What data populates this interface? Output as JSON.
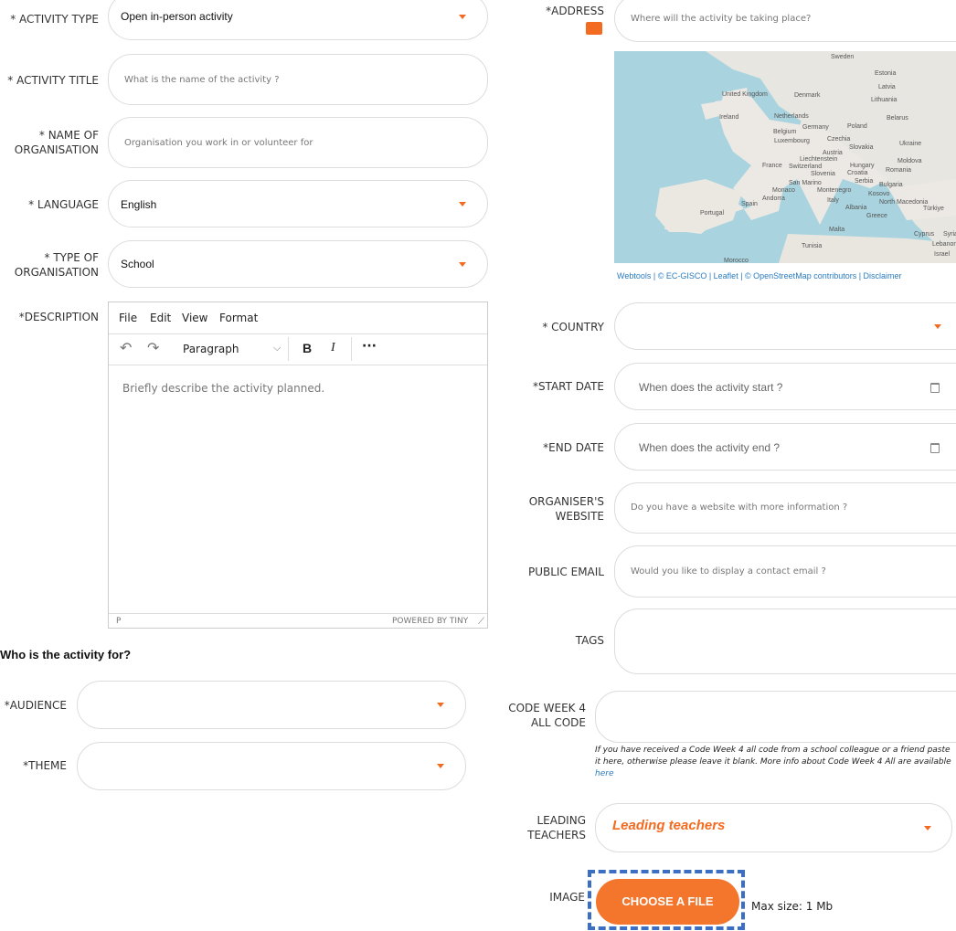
{
  "left": {
    "activity_type": {
      "label": "* ACTIVITY TYPE",
      "value": "Open in-person activity"
    },
    "activity_title": {
      "label": "* ACTIVITY TITLE",
      "placeholder": "What is the name of the activity ?"
    },
    "organisation_name": {
      "label_1": "* NAME OF",
      "label_2": "ORGANISATION",
      "placeholder": "Organisation you work in or volunteer for"
    },
    "language": {
      "label": "* LANGUAGE",
      "value": "English"
    },
    "organisation_type": {
      "label_1": "* TYPE OF",
      "label_2": "ORGANISATION",
      "value": "School"
    },
    "description": {
      "label": "*DESCRIPTION",
      "menu": [
        "File",
        "Edit",
        "View",
        "Format"
      ],
      "block_format": "Paragraph",
      "placeholder": "Briefly describe the activity planned.",
      "path": "P",
      "powered_by": "POWERED BY TINY"
    },
    "section_heading": "Who is the activity for?",
    "audience": {
      "label": "*AUDIENCE"
    },
    "theme": {
      "label": "*THEME"
    }
  },
  "right": {
    "address": {
      "label": "*ADDRESS",
      "placeholder": "Where will the activity be taking place?"
    },
    "map": {
      "labels": [
        "Sweden",
        "Estonia",
        "Latvia",
        "Lithuania",
        "United Kingdom",
        "Denmark",
        "Ireland",
        "Netherlands",
        "Belgium",
        "Germany",
        "Poland",
        "Belarus",
        "Luxembourg",
        "Czechia",
        "Slovakia",
        "Ukraine",
        "France",
        "Liechtenstein",
        "Switzerland",
        "Austria",
        "Hungary",
        "Moldova",
        "Slovenia",
        "Croatia",
        "Romania",
        "San Marino",
        "Serbia",
        "Monaco",
        "Montenegro",
        "Bulgaria",
        "Kosovo",
        "Andorra",
        "Italy",
        "Albania",
        "North Macedonia",
        "Spain",
        "Portugal",
        "Greece",
        "Türkiye",
        "Malta",
        "Tunisia",
        "Cyprus",
        "Syria",
        "Lebanon",
        "Israel",
        "Morocco"
      ],
      "attribution": "Webtools | © EC-GISCO | Leaflet | © OpenStreetMap contributors | Disclaimer"
    },
    "country": {
      "label": "* COUNTRY"
    },
    "start_date": {
      "label": "*START DATE",
      "placeholder": "When does the activity start ?"
    },
    "end_date": {
      "label": "*END DATE",
      "placeholder": "When does the activity end ?"
    },
    "website": {
      "label_1": "ORGANISER'S",
      "label_2": "WEBSITE",
      "placeholder": "Do you have a website with more information ?"
    },
    "public_email": {
      "label": "PUBLIC EMAIL",
      "placeholder": "Would you like to display a contact email ?"
    },
    "tags": {
      "label": "TAGS"
    },
    "code": {
      "label_1": "CODE WEEK 4",
      "label_2": "ALL CODE",
      "help_text": "If you have received a Code Week 4 all code from a school colleague or a friend paste it here, otherwise please leave it blank. More info about Code Week 4 All are available",
      "help_link": "here"
    },
    "leading_teachers": {
      "label_1": "LEADING",
      "label_2": "TEACHERS",
      "placeholder": "Leading teachers"
    },
    "image": {
      "label": "IMAGE",
      "button": "CHOOSE A FILE",
      "max_size": "Max size: 1 Mb"
    }
  },
  "colors": {
    "accent": "#f26b21",
    "button": "#f4762d",
    "link": "#2a7bbf",
    "dashed_border": "#3b6fc4"
  }
}
